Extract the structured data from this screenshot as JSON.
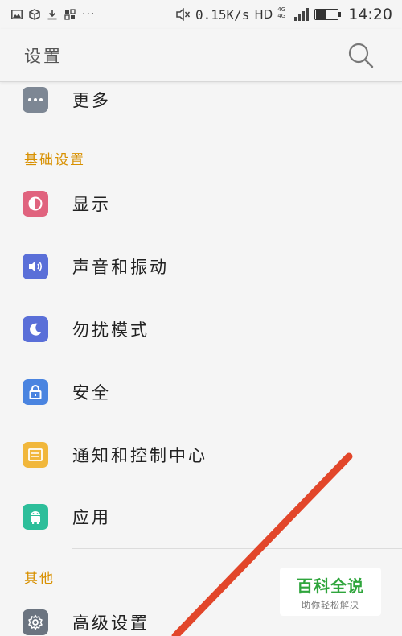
{
  "status_bar": {
    "net_speed": "0.15K/s",
    "network": "HD",
    "signal_tag": "4G 4G",
    "time": "14:20",
    "battery_level": 0.45,
    "overflow": "···"
  },
  "header": {
    "title": "设置"
  },
  "rows": {
    "more": {
      "label": "更多",
      "icon": "more-icon",
      "color": "#7d8794"
    },
    "display": {
      "label": "显示",
      "icon": "display-icon",
      "color": "#e0637e"
    },
    "sound": {
      "label": "声音和振动",
      "icon": "speaker-icon",
      "color": "#5a6fd8"
    },
    "dnd": {
      "label": "勿扰模式",
      "icon": "moon-icon",
      "color": "#5a6fd8"
    },
    "security": {
      "label": "安全",
      "icon": "lock-icon",
      "color": "#4a84e0"
    },
    "notification": {
      "label": "通知和控制中心",
      "icon": "notification-icon",
      "color": "#f1b73b"
    },
    "apps": {
      "label": "应用",
      "icon": "android-icon",
      "color": "#2dbe9a"
    },
    "advanced": {
      "label": "高级设置",
      "icon": "gear-icon",
      "color": "#6b7480"
    }
  },
  "sections": {
    "basic": "基础设置",
    "other": "其他"
  },
  "colors": {
    "section_header": "#d89000",
    "annotation_arrow": "#e2462a"
  },
  "watermark": {
    "title": "百科全说",
    "subtitle": "助你轻松解决"
  }
}
